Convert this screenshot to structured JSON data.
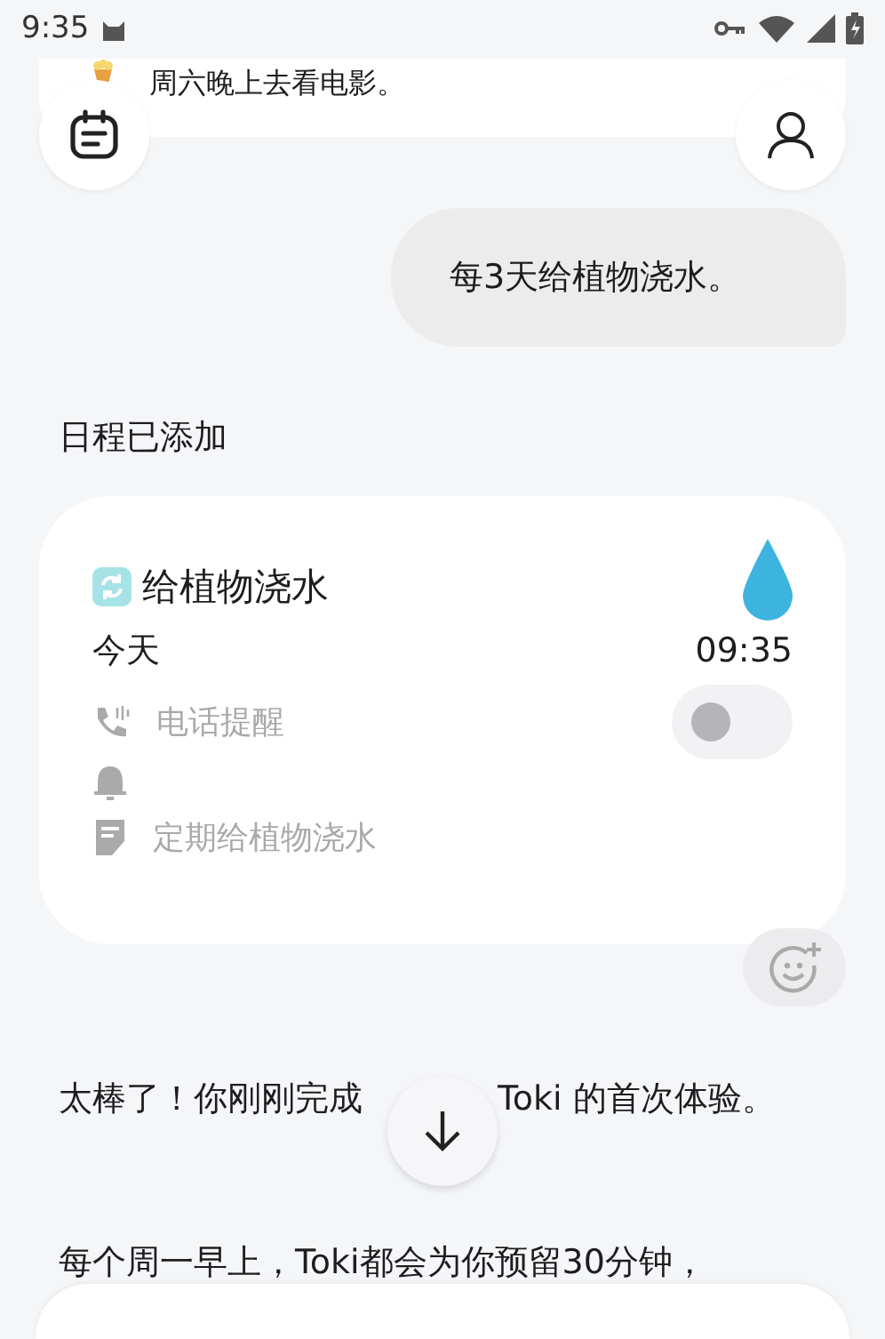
{
  "status_bar": {
    "time": "9:35"
  },
  "previous_event": {
    "text": "周六晚上去看电影。"
  },
  "user_message": "每3天给植物浇水。",
  "status_text": "日程已添加",
  "schedule_card": {
    "title": "给植物浇水",
    "date": "今天",
    "time": "09:35",
    "phone_reminder": {
      "label": "电话提醒",
      "on": false
    },
    "note": "定期给植物浇水"
  },
  "reply": {
    "before": "太棒了！你刚刚完成",
    "after": "Toki 的首次体验。"
  },
  "next_message": "每个周一早上，Toki都会为你预留30分钟，"
}
